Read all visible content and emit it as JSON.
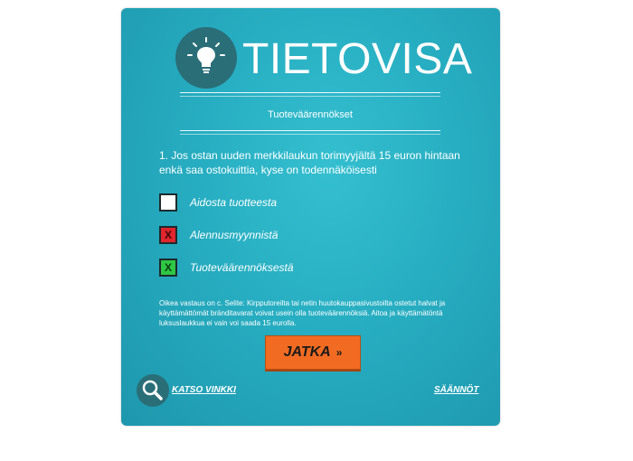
{
  "logo": {
    "title": "TIETOVISA",
    "icon": "lightbulb-icon"
  },
  "subtitle": "Tuoteväärennökset",
  "question": "1. Jos ostan uuden merkkilaukun torimyyjältä 15 euron hintaan enkä saa ostokuittia, kyse on todennäköisesti",
  "options": [
    {
      "label": "Aidosta tuotteesta",
      "state": "unselected",
      "mark": ""
    },
    {
      "label": "Alennusmyynnistä",
      "state": "wrong",
      "mark": "X"
    },
    {
      "label": "Tuoteväärennöksestä",
      "state": "correct",
      "mark": "X"
    }
  ],
  "explanation": "Oikea vastaus on c. Selite: Kirpputoreilta tai netin huutokauppasivustoilta ostetut halvat ja käyttämättömät bränditavarat voivat usein olla tuoteväärennöksiä. Aitoa ja käyttämätöntä luksuslaukkua ei vain voi saada 15 eurolla.",
  "continue_button": {
    "label": "JATKA",
    "arrow": "»"
  },
  "hint": {
    "label": "KATSO VINKKI",
    "icon": "search-icon"
  },
  "rules": {
    "label": "SÄÄNNÖT"
  },
  "colors": {
    "card": "#27adc1",
    "button": "#f26b22",
    "wrong": "#e0252d",
    "correct": "#2ec844",
    "icon_circle": "#2a6e78"
  }
}
